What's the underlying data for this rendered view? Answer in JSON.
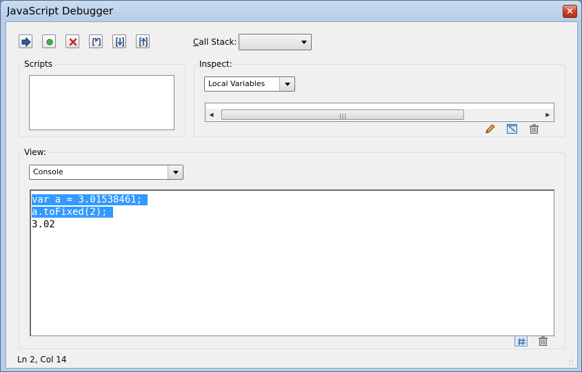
{
  "window": {
    "title": "JavaScript Debugger",
    "close_glyph": "×"
  },
  "toolbar": {
    "buttons": [
      {
        "name": "continue-button",
        "icon": "run-arrow-icon"
      },
      {
        "name": "break-button",
        "icon": "green-dot-icon"
      },
      {
        "name": "stop-button",
        "icon": "red-x-icon"
      },
      {
        "name": "step-over-button",
        "icon": "step-over-icon"
      },
      {
        "name": "step-into-button",
        "icon": "step-into-icon"
      },
      {
        "name": "step-out-button",
        "icon": "step-out-icon"
      }
    ],
    "callstack_label_accel": "C",
    "callstack_label_rest": "all Stack:",
    "callstack_value": ""
  },
  "scripts": {
    "label": "Scripts"
  },
  "inspect": {
    "label": "Inspect:",
    "selected": "Local Variables",
    "scroll_left_glyph": "◀",
    "scroll_right_glyph": "▶",
    "grip_glyph": "|||"
  },
  "view": {
    "label": "View:",
    "selected": "Console",
    "console_lines": [
      {
        "text": "var a = 3.01538461;",
        "selected": true
      },
      {
        "text": "a.toFixed(2);",
        "selected": true
      },
      {
        "text": "3.02",
        "selected": false
      }
    ]
  },
  "status": {
    "text": "Ln 2, Col 14"
  },
  "colors": {
    "selection": "#3399ff",
    "title_gradient": "#c9dcf0"
  }
}
